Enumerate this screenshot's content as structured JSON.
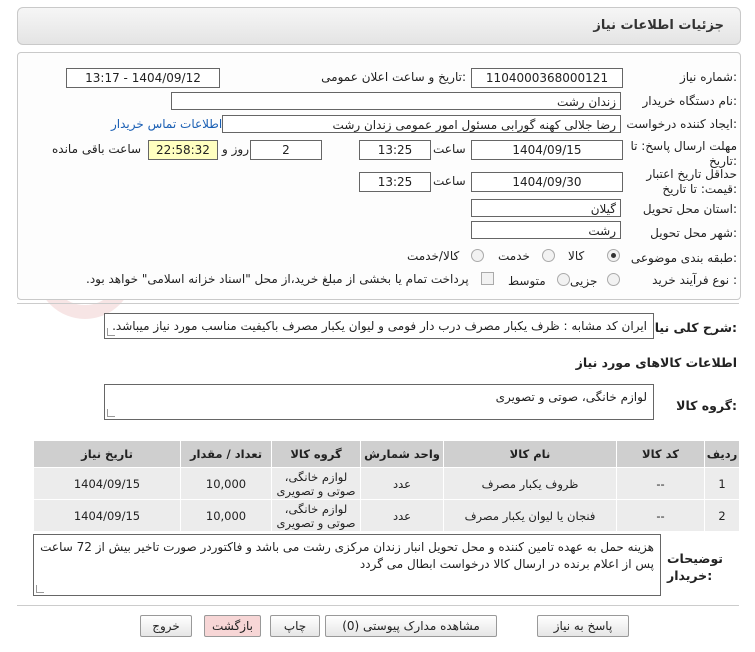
{
  "header": {
    "title": "جزئیات اطلاعات نیاز"
  },
  "need_number": {
    "label": "شماره نیاز:",
    "value": "1104000368000121"
  },
  "announce": {
    "label": "تاریخ و ساعت اعلان عمومی:",
    "value": "1404/09/12 - 13:17"
  },
  "buyer_org": {
    "label": "نام دستگاه خریدار:",
    "value": "زندان رشت"
  },
  "creator": {
    "label": "ایجاد کننده درخواست:",
    "value": "رضا جلالی کهنه گورابی مسئول امور عمومی زندان رشت",
    "contact_link": "اطلاعات تماس خریدار"
  },
  "reply_deadline": {
    "label": "مهلت ارسال پاسخ: تا تاریخ:",
    "date": "1404/09/15",
    "time_label": "ساعت",
    "time": "13:25",
    "days": "2",
    "days_label": "روز و",
    "remaining": "22:58:32",
    "remaining_label": "ساعت باقی مانده"
  },
  "price_validity": {
    "label": "حداقل تاریخ اعتبار قیمت: تا تاریخ:",
    "date": "1404/09/30",
    "time_label": "ساعت",
    "time": "13:25"
  },
  "province": {
    "label": "استان محل تحویل:",
    "value": "گیلان"
  },
  "city": {
    "label": "شهر محل تحویل:",
    "value": "رشت"
  },
  "category": {
    "label": "طبقه بندی موضوعی:",
    "options": [
      "کالا",
      "خدمت",
      "کالا/خدمت"
    ]
  },
  "process": {
    "label": "نوع فرآیند خرید :",
    "options": [
      "جزیی",
      "متوسط"
    ],
    "payment_note": "پرداخت تمام یا بخشی از مبلغ خرید،از محل \"اسناد خزانه اسلامی\" خواهد بود."
  },
  "description": {
    "label": "شرح کلی نیاز:",
    "value": "ایران کد مشابه : ظرف یکبار مصرف  درب دار فومی  و لیوان یکبار مصرف باکیفیت مناسب مورد نیاز میباشد."
  },
  "goods_info": {
    "title": "اطلاعات کالاهای مورد نیاز"
  },
  "goods_group": {
    "label": "گروه کالا:",
    "value": "لوازم خانگی، صوتی و تصویری"
  },
  "table": {
    "headers": [
      "ردیف",
      "کد کالا",
      "نام کالا",
      "واحد شمارش",
      "گروه کالا",
      "تعداد / مقدار",
      "تاریخ نیاز"
    ],
    "rows": [
      [
        "1",
        "--",
        "ظروف یکبار مصرف",
        "عدد",
        "لوازم خانگی، صوتی و تصویری",
        "10,000",
        "1404/09/15"
      ],
      [
        "2",
        "--",
        "فنجان یا لیوان یکبار مصرف",
        "عدد",
        "لوازم خانگی، صوتی و تصویری",
        "10,000",
        "1404/09/15"
      ]
    ]
  },
  "buyer_notes": {
    "label": "توضیحات خریدار:",
    "value": "هزینه حمل به عهده تامین کننده و محل تحویل انبار زندان مرکزی رشت می باشد و فاکتوردر صورت تاخیر بیش از 72 ساعت پس از اعلام برنده در ارسال کالا درخواست ابطال می گردد"
  },
  "buttons": {
    "reply": "پاسخ به نیاز",
    "attachments": "مشاهده مدارک پیوستی (0)",
    "print": "چاپ",
    "back": "بازگشت",
    "exit": "خروج"
  },
  "watermark": {
    "text": "AriaTender.neT"
  },
  "colors": {
    "back_button_bg": "#f7d6d6",
    "yellow_box": "#ffffc0",
    "link": "#1a5fb4"
  }
}
